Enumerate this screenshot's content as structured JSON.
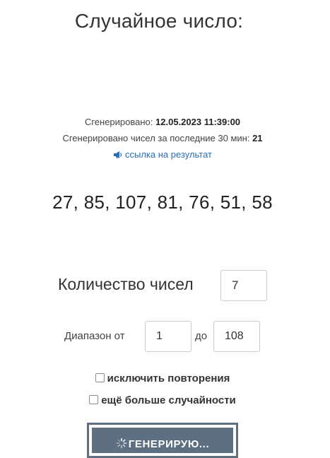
{
  "page": {
    "title": "Случайное число:"
  },
  "meta": {
    "generated_label": "Сгенерировано:",
    "generated_value": "12.05.2023 11:39:00",
    "count_30min_label": "Сгенерировано чисел за последние 30 мин:",
    "count_30min_value": "21",
    "result_link_label": "ссылка на результат",
    "result_link_icon": "megaphone-icon"
  },
  "result": {
    "numbers_text": "27, 85, 107, 81, 76, 51, 58",
    "numbers": [
      27,
      85,
      107,
      81,
      76,
      51,
      58
    ]
  },
  "form": {
    "count_label": "Количество чисел",
    "count_value": "7",
    "range_from_label": "Диапазон от",
    "range_from_value": "1",
    "range_to_label": "до",
    "range_to_value": "108",
    "exclude_repeats_label": "исключить повторения",
    "exclude_repeats_checked": false,
    "more_random_label": "ещё больше случайности",
    "more_random_checked": false
  },
  "generate_button": {
    "label": "ГЕНЕРИРУЮ...",
    "icon": "spinner-icon",
    "color": "#5d6f80"
  },
  "colors": {
    "link": "#2a6fb8",
    "text": "#333333",
    "button_bg": "#5d6f80"
  }
}
